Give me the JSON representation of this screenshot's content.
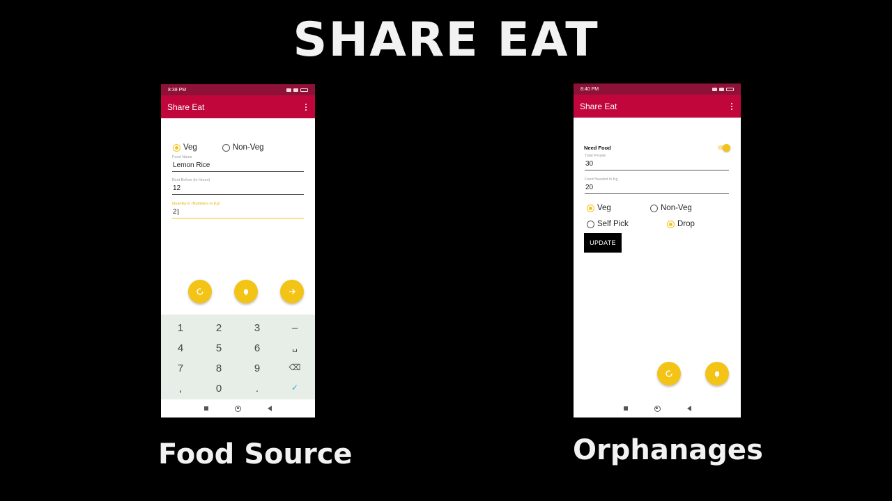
{
  "title": "SHARE EAT",
  "captions": {
    "left": "Food Source",
    "right": "Orphanages"
  },
  "colors": {
    "status_bar": "#8e1238",
    "app_bar": "#c1063c",
    "accent": "#f3c316",
    "background": "#000000"
  },
  "food_source": {
    "status_time": "8:38 PM",
    "app_title": "Share Eat",
    "radio": {
      "veg": "Veg",
      "non_veg": "Non-Veg",
      "selected": "Veg"
    },
    "fields": [
      {
        "label": "Food Name",
        "value": "Lemon Rice"
      },
      {
        "label": "Best Before (in Hours)",
        "value": "12"
      },
      {
        "label": "Quantity in (Numbers or Kg)",
        "value": "2"
      }
    ],
    "fabs": [
      "refresh-icon",
      "bell-icon",
      "arrow-right-icon"
    ],
    "keypad": {
      "keys": [
        "1",
        "2",
        "3",
        "–",
        "4",
        "5",
        "6",
        "␣",
        "7",
        "8",
        "9",
        "⌫",
        ",",
        "0",
        ".",
        "✓"
      ]
    }
  },
  "orphanage": {
    "status_time": "8:40 PM",
    "app_title": "Share Eat",
    "need_food_label": "Need Food",
    "need_food_on": true,
    "fields": [
      {
        "label": "Total People",
        "value": "30"
      },
      {
        "label": "Food Needed in Kg",
        "value": "20"
      }
    ],
    "radio_diet": {
      "veg": "Veg",
      "non_veg": "Non-Veg",
      "selected": "Veg"
    },
    "radio_delivery": {
      "self_pick": "Self Pick",
      "drop": "Drop",
      "selected": "Drop"
    },
    "update_label": "UPDATE",
    "fabs": [
      "refresh-icon",
      "bell-icon"
    ]
  }
}
